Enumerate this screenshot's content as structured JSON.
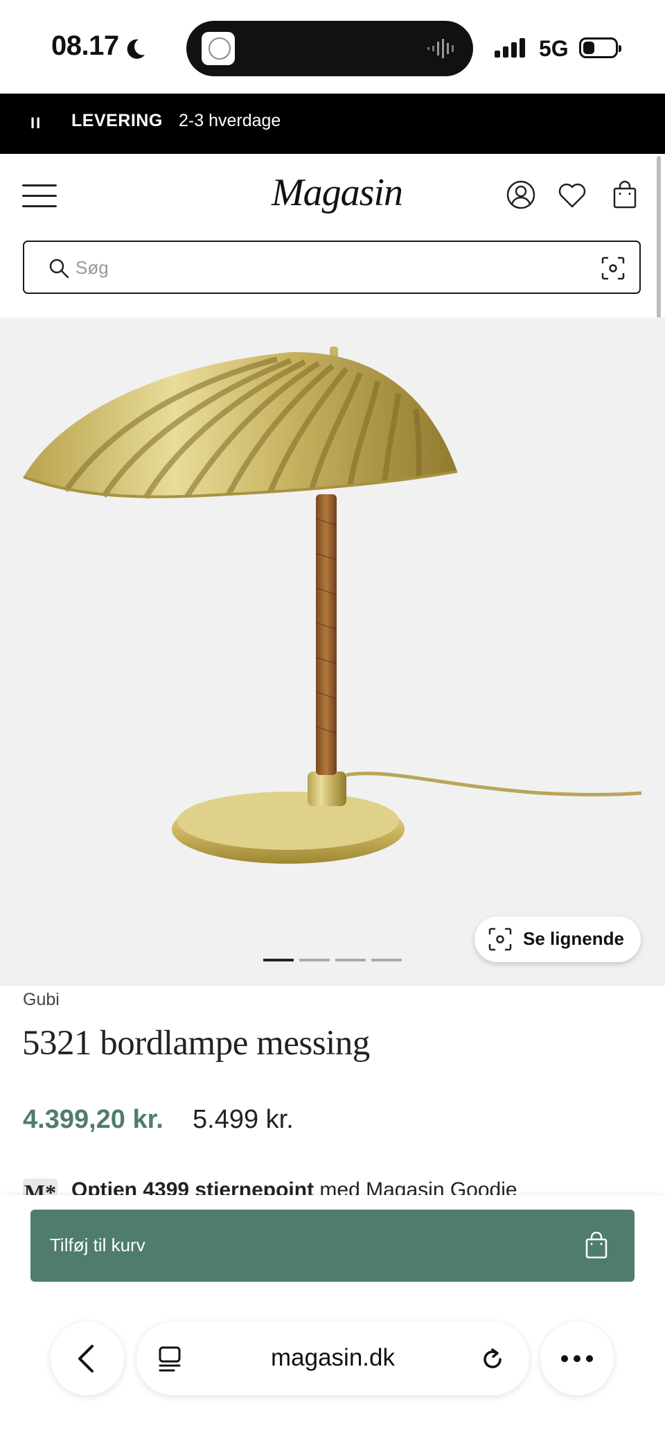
{
  "status_bar": {
    "time": "08.17",
    "network": "5G"
  },
  "promo": {
    "label": "LEVERING",
    "value": "2-3 hverdage",
    "pause_symbol": "II"
  },
  "header": {
    "logo": "Magasin"
  },
  "search": {
    "placeholder": "Søg"
  },
  "gallery": {
    "similar_label": "Se lignende",
    "slide_count": 4,
    "active_slide": 1
  },
  "product": {
    "brand": "Gubi",
    "title": "5321 bordlampe messing",
    "price_sale": "4.399,20 kr.",
    "price_original": "5.499 kr.",
    "points_badge": "M*",
    "points_bold": "Optjen 4399 stjernepoint",
    "points_rest": " med Magasin Goodie"
  },
  "cart_button": {
    "label": "Tilføj til kurv"
  },
  "browser": {
    "url": "magasin.dk"
  },
  "colors": {
    "accent": "#4f7c6d",
    "promo_bg": "#000000",
    "hero_bg": "#f1f1f1"
  }
}
